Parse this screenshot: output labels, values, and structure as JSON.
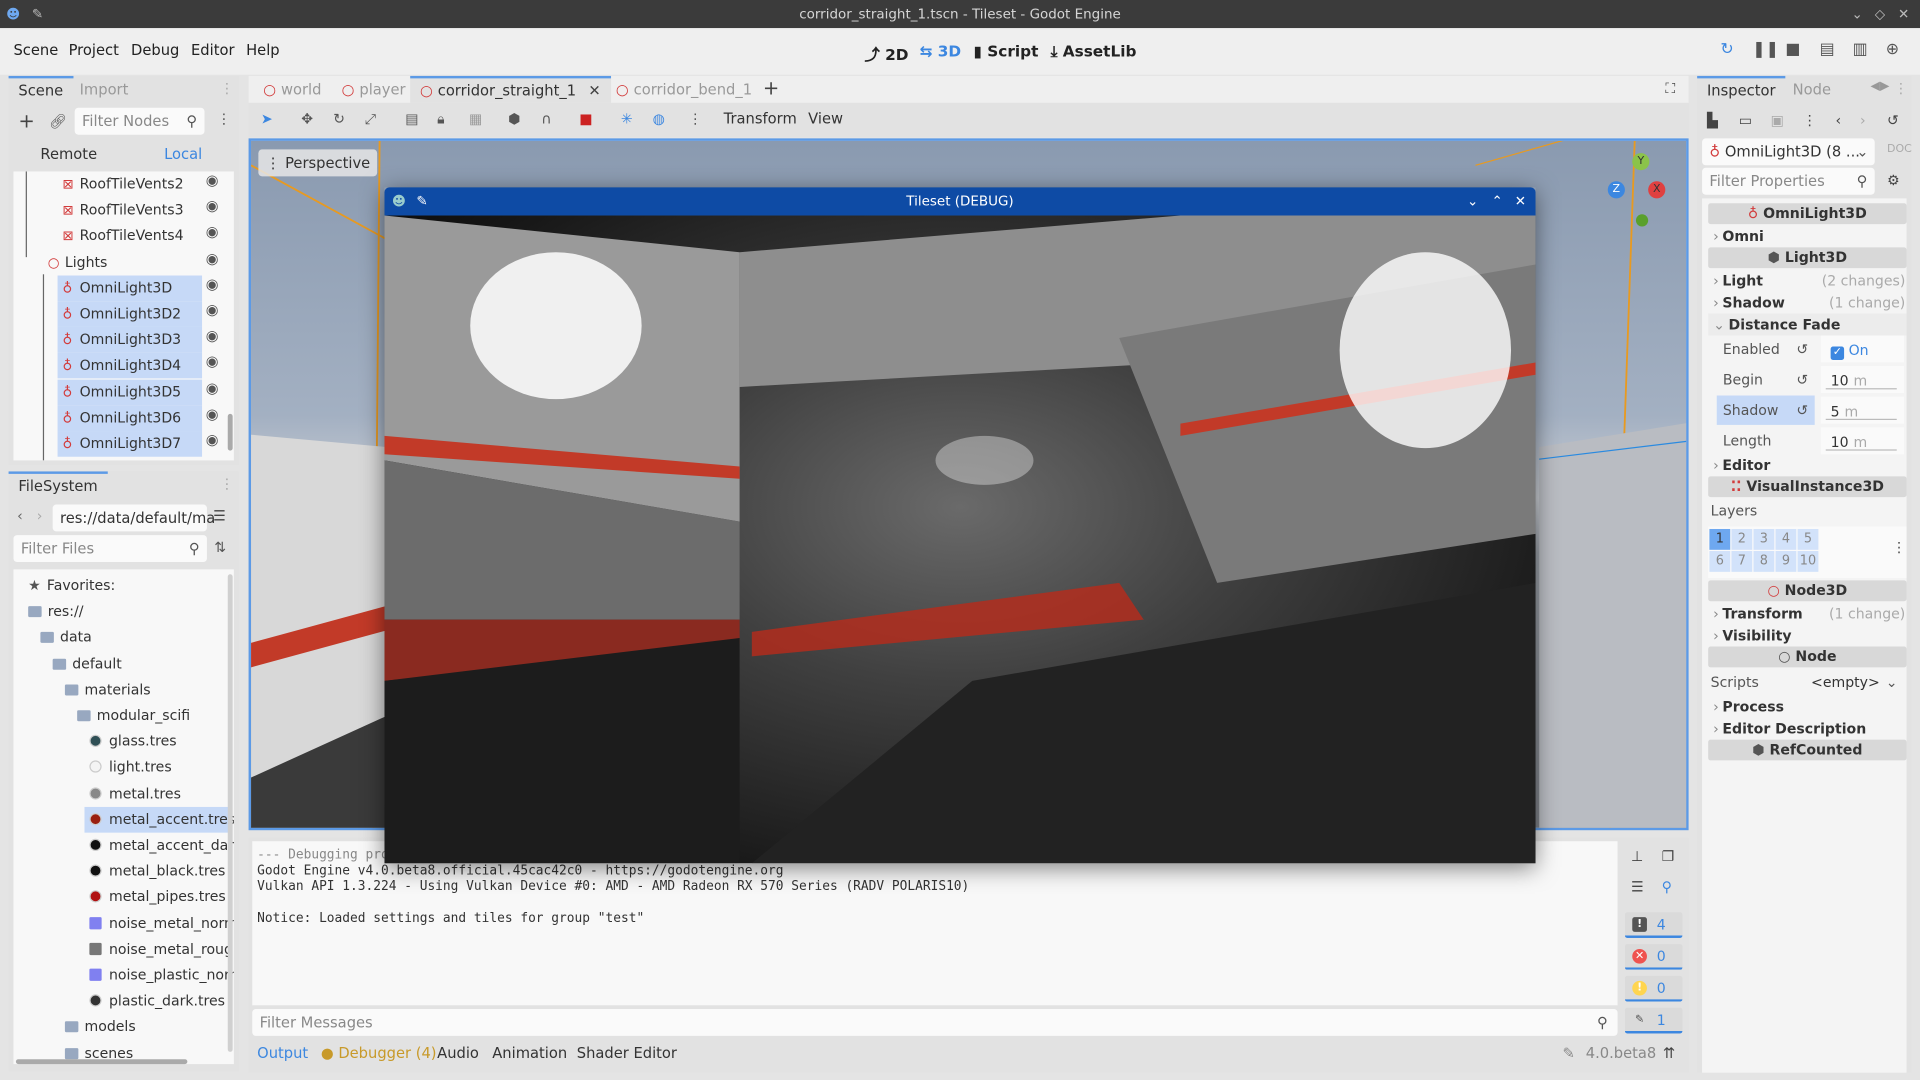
{
  "window": {
    "title": "corridor_straight_1.tscn - Tileset - Godot Engine"
  },
  "menu": [
    "Scene",
    "Project",
    "Debug",
    "Editor",
    "Help"
  ],
  "workspaces": [
    {
      "label": "2D",
      "active": false
    },
    {
      "label": "3D",
      "active": true
    },
    {
      "label": "Script",
      "active": false
    },
    {
      "label": "AssetLib",
      "active": false
    }
  ],
  "scene_dock": {
    "tabs": [
      "Scene",
      "Import"
    ],
    "filter_placeholder": "Filter Nodes",
    "remote": "Remote",
    "local": "Local",
    "tree": [
      {
        "label": "RoofTileVents2",
        "icon": "mesh-icon",
        "selected": false
      },
      {
        "label": "RoofTileVents3",
        "icon": "mesh-icon",
        "selected": false
      },
      {
        "label": "RoofTileVents4",
        "icon": "mesh-icon",
        "selected": false
      },
      {
        "label": "Lights",
        "icon": "node3d-icon",
        "selected": false
      },
      {
        "label": "OmniLight3D",
        "icon": "omnilight-icon",
        "selected": true
      },
      {
        "label": "OmniLight3D2",
        "icon": "omnilight-icon",
        "selected": true
      },
      {
        "label": "OmniLight3D3",
        "icon": "omnilight-icon",
        "selected": true
      },
      {
        "label": "OmniLight3D4",
        "icon": "omnilight-icon",
        "selected": true
      },
      {
        "label": "OmniLight3D5",
        "icon": "omnilight-icon",
        "selected": true
      },
      {
        "label": "OmniLight3D6",
        "icon": "omnilight-icon",
        "selected": true
      },
      {
        "label": "OmniLight3D7",
        "icon": "omnilight-icon",
        "selected": true
      }
    ]
  },
  "filesystem": {
    "tab": "FileSystem",
    "path": "res://data/default/ma",
    "filter_placeholder": "Filter Files",
    "items": [
      {
        "label": "Favorites:",
        "type": "favorites",
        "depth": 0
      },
      {
        "label": "res://",
        "type": "folder",
        "depth": 0
      },
      {
        "label": "data",
        "type": "folder",
        "depth": 1
      },
      {
        "label": "default",
        "type": "folder",
        "depth": 2
      },
      {
        "label": "materials",
        "type": "folder",
        "depth": 3
      },
      {
        "label": "modular_scifi",
        "type": "folder",
        "depth": 4
      },
      {
        "label": "glass.tres",
        "type": "file",
        "color": "#2f4f55",
        "depth": 5
      },
      {
        "label": "light.tres",
        "type": "file",
        "color": "#f4f4f4",
        "depth": 5
      },
      {
        "label": "metal.tres",
        "type": "file",
        "color": "#888888",
        "depth": 5
      },
      {
        "label": "metal_accent.tres",
        "type": "file",
        "color": "#9a1f10",
        "depth": 5,
        "selected": true
      },
      {
        "label": "metal_accent_dark.",
        "type": "file",
        "color": "#111111",
        "depth": 5
      },
      {
        "label": "metal_black.tres",
        "type": "file",
        "color": "#111111",
        "depth": 5
      },
      {
        "label": "metal_pipes.tres",
        "type": "file",
        "color": "#b01010",
        "depth": 5
      },
      {
        "label": "noise_metal_norm.",
        "type": "texture",
        "color": "#8080f0",
        "depth": 5
      },
      {
        "label": "noise_metal_rough",
        "type": "texture",
        "color": "#777777",
        "depth": 5
      },
      {
        "label": "noise_plastic_norm",
        "type": "texture",
        "color": "#8080f0",
        "depth": 5
      },
      {
        "label": "plastic_dark.tres",
        "type": "file",
        "color": "#333333",
        "depth": 5
      },
      {
        "label": "models",
        "type": "folder",
        "depth": 3
      },
      {
        "label": "scenes",
        "type": "folder",
        "depth": 3
      }
    ]
  },
  "scene_tabs": [
    {
      "label": "world",
      "active": false
    },
    {
      "label": "player",
      "active": false
    },
    {
      "label": "corridor_straight_1",
      "active": true
    },
    {
      "label": "corridor_bend_1",
      "active": false
    }
  ],
  "viewport": {
    "toolbar_menus": [
      "Transform",
      "View"
    ],
    "perspective": "Perspective",
    "gizmo": {
      "y": "Y",
      "z": "Z",
      "x": "X"
    }
  },
  "game_window": {
    "title": "Tileset (DEBUG)"
  },
  "output": {
    "lines": [
      "--- Debugging process started ---",
      "Godot Engine v4.0.beta8.official.45cac42c0 - https://godotengine.org",
      "Vulkan API 1.3.224 - Using Vulkan Device #0: AMD - AMD Radeon RX 570 Series (RADV POLARIS10)",
      "",
      "Notice: Loaded settings and tiles for group \"test\""
    ],
    "filter_placeholder": "Filter Messages",
    "counts": {
      "messages": "4",
      "errors": "0",
      "warnings": "0",
      "editor": "1"
    }
  },
  "bottom_tabs": [
    "Output",
    "Debugger (4)",
    "Audio",
    "Animation",
    "Shader Editor"
  ],
  "version": "4.0.beta8",
  "inspector": {
    "tabs": [
      "Inspector",
      "Node"
    ],
    "object": "OmniLight3D (8 ...",
    "filter_placeholder": "Filter Properties",
    "class_omni": "OmniLight3D",
    "omni": "Omni",
    "class_light": "Light3D",
    "light": "Light",
    "light_changes": "(2 changes)",
    "shadow": "Shadow",
    "shadow_changes": "(1 change)",
    "distance_fade": "Distance Fade",
    "enabled_label": "Enabled",
    "enabled_value": "On",
    "enabled": true,
    "begin_label": "Begin",
    "begin_value": "10",
    "shadow_label": "Shadow",
    "shadow_value": "5",
    "length_label": "Length",
    "length_value": "10",
    "unit": "m",
    "editor": "Editor",
    "class_visual": "VisualInstance3D",
    "layers_label": "Layers",
    "layers": [
      "1",
      "2",
      "3",
      "4",
      "5",
      "6",
      "7",
      "8",
      "9",
      "10"
    ],
    "layers_active": [
      "1"
    ],
    "class_node3d": "Node3D",
    "transform": "Transform",
    "transform_changes": "(1 change)",
    "visibility": "Visibility",
    "class_node": "Node",
    "scripts_label": "Scripts",
    "scripts_value": "<empty>",
    "process": "Process",
    "editor_description": "Editor Description",
    "class_refcounted": "RefCounted"
  }
}
